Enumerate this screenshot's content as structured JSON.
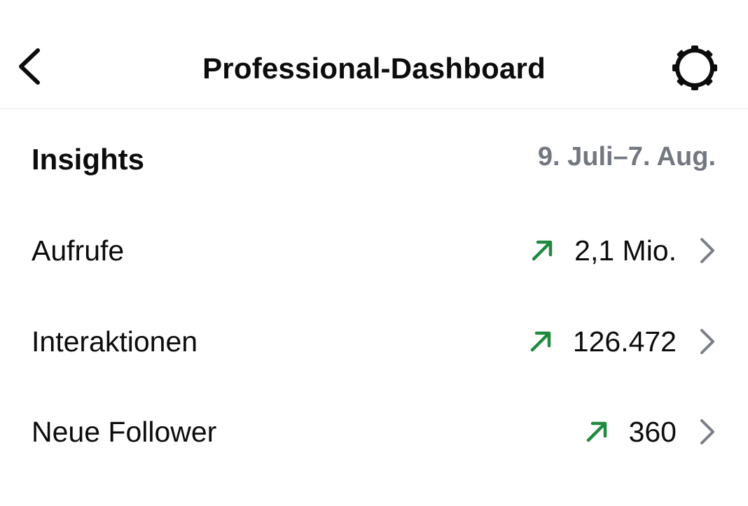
{
  "header": {
    "title": "Professional-Dashboard",
    "back_icon": "chevron-left-icon",
    "settings_icon": "gear-icon"
  },
  "insights": {
    "title": "Insights",
    "date_range": "9. Juli–7. Aug."
  },
  "metrics": [
    {
      "label": "Aufrufe",
      "value": "2,1 Mio.",
      "trend": "up",
      "trend_icon": "trend-up-arrow-icon"
    },
    {
      "label": "Interaktionen",
      "value": "126.472",
      "trend": "up",
      "trend_icon": "trend-up-arrow-icon"
    },
    {
      "label": "Neue Follower",
      "value": "360",
      "trend": "up",
      "trend_icon": "trend-up-arrow-icon"
    }
  ],
  "colors": {
    "text": "#0c0c0c",
    "secondary_text": "#737780",
    "trend_up": "#1f8a3f",
    "chevron": "#7a7e87",
    "divider": "#e9e9ec"
  }
}
